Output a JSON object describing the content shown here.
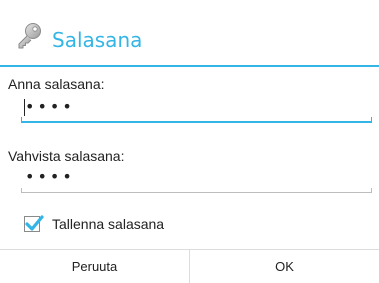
{
  "dialog": {
    "title": "Salasana",
    "title_icon": "key-icon",
    "accent_color": "#33b5e5"
  },
  "password": {
    "label": "Anna salasana:",
    "value": "••••"
  },
  "confirm": {
    "label": "Vahvista salasana:",
    "value": "••••"
  },
  "save_password": {
    "label": "Tallenna salasana",
    "checked": true
  },
  "buttons": {
    "cancel_label": "Peruuta",
    "ok_label": "OK"
  }
}
